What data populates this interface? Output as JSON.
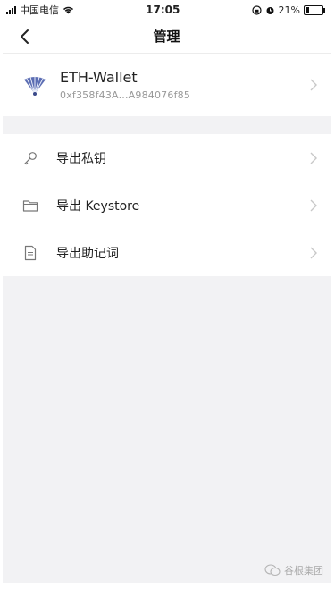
{
  "statusbar": {
    "carrier": "中国电信",
    "time": "17:05",
    "battery": "21%",
    "battery_level": 0.21
  },
  "nav": {
    "title": "管理"
  },
  "wallet": {
    "name": "ETH-Wallet",
    "address": "0xf358f43A...A984076f85"
  },
  "menu": {
    "items": [
      {
        "label": "导出私钥",
        "icon": "key-icon"
      },
      {
        "label": "导出 Keystore",
        "icon": "folder-icon"
      },
      {
        "label": "导出助记词",
        "icon": "document-icon"
      }
    ]
  },
  "watermark": {
    "text": "谷根集团"
  }
}
